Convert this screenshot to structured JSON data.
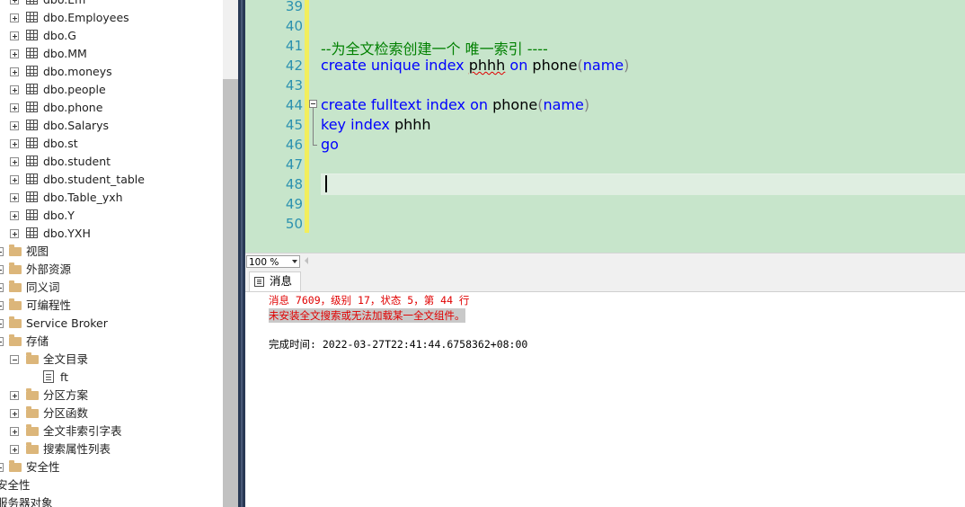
{
  "explorer": {
    "items": [
      {
        "label": "dbo.Em",
        "type": "table"
      },
      {
        "label": "dbo.Employees",
        "type": "table"
      },
      {
        "label": "dbo.G",
        "type": "table"
      },
      {
        "label": "dbo.MM",
        "type": "table"
      },
      {
        "label": "dbo.moneys",
        "type": "table"
      },
      {
        "label": "dbo.people",
        "type": "table"
      },
      {
        "label": "dbo.phone",
        "type": "table"
      },
      {
        "label": "dbo.Salarys",
        "type": "table"
      },
      {
        "label": "dbo.st",
        "type": "table"
      },
      {
        "label": "dbo.student",
        "type": "table"
      },
      {
        "label": "dbo.student_table",
        "type": "table"
      },
      {
        "label": "dbo.Table_yxh",
        "type": "table"
      },
      {
        "label": "dbo.Y",
        "type": "table"
      },
      {
        "label": "dbo.YXH",
        "type": "table"
      },
      {
        "label": "视图",
        "type": "folder"
      },
      {
        "label": "外部资源",
        "type": "folder"
      },
      {
        "label": "同义词",
        "type": "folder"
      },
      {
        "label": "可编程性",
        "type": "folder"
      },
      {
        "label": "Service Broker",
        "type": "folder"
      },
      {
        "label": "存储",
        "type": "folder"
      },
      {
        "label": "全文目录",
        "type": "folder"
      },
      {
        "label": "ft",
        "type": "catalog"
      },
      {
        "label": "分区方案",
        "type": "folder"
      },
      {
        "label": "分区函数",
        "type": "folder"
      },
      {
        "label": "全文非索引字表",
        "type": "folder"
      },
      {
        "label": "搜索属性列表",
        "type": "folder"
      },
      {
        "label": "安全性",
        "type": "folder"
      },
      {
        "label": "安全性",
        "type": "none"
      },
      {
        "label": "服务器对象",
        "type": "none"
      }
    ]
  },
  "editor": {
    "lines": [
      {
        "num": "39",
        "tokens": []
      },
      {
        "num": "40",
        "tokens": []
      },
      {
        "num": "41",
        "tokens": [
          {
            "t": "--为全文检索创建一个 唯一索引 ----",
            "c": "cm"
          }
        ]
      },
      {
        "num": "42",
        "tokens": [
          {
            "t": "create",
            "c": "kw"
          },
          {
            "t": " ",
            "c": "tx"
          },
          {
            "t": "unique",
            "c": "kw"
          },
          {
            "t": " ",
            "c": "tx"
          },
          {
            "t": "index",
            "c": "kw"
          },
          {
            "t": " ",
            "c": "tx"
          },
          {
            "t": "phhh",
            "c": "tx",
            "squiggle": true
          },
          {
            "t": " ",
            "c": "tx"
          },
          {
            "t": "on",
            "c": "kw"
          },
          {
            "t": " phone",
            "c": "tx"
          },
          {
            "t": "(",
            "c": "gr"
          },
          {
            "t": "name",
            "c": "kw"
          },
          {
            "t": ")",
            "c": "gr"
          }
        ]
      },
      {
        "num": "43",
        "tokens": []
      },
      {
        "num": "44",
        "tokens": [
          {
            "t": "create",
            "c": "kw"
          },
          {
            "t": " ",
            "c": "tx"
          },
          {
            "t": "fulltext",
            "c": "kw"
          },
          {
            "t": " ",
            "c": "tx"
          },
          {
            "t": "index",
            "c": "kw"
          },
          {
            "t": " ",
            "c": "tx"
          },
          {
            "t": "on",
            "c": "kw"
          },
          {
            "t": " phone",
            "c": "tx"
          },
          {
            "t": "(",
            "c": "gr"
          },
          {
            "t": "name",
            "c": "kw"
          },
          {
            "t": ")",
            "c": "gr"
          }
        ]
      },
      {
        "num": "45",
        "tokens": [
          {
            "t": "key",
            "c": "kw"
          },
          {
            "t": " ",
            "c": "tx"
          },
          {
            "t": "index",
            "c": "kw"
          },
          {
            "t": " phhh",
            "c": "tx"
          }
        ]
      },
      {
        "num": "46",
        "tokens": [
          {
            "t": "go",
            "c": "kw"
          }
        ]
      },
      {
        "num": "47",
        "tokens": []
      },
      {
        "num": "48",
        "tokens": []
      },
      {
        "num": "49",
        "tokens": []
      },
      {
        "num": "50",
        "tokens": []
      }
    ]
  },
  "zoom": {
    "value": "100 %"
  },
  "results": {
    "tab_label": "消息",
    "error_line": "消息 7609，级别 17，状态 5，第 44 行",
    "error_detail": "未安装全文搜索或无法加载某一全文组件。",
    "completion": "完成时间: 2022-03-27T22:41:44.6758362+08:00"
  },
  "colors": {
    "editor_bg": "#c7e5cb",
    "keyword": "#0000ff",
    "comment": "#008000",
    "line_number": "#2b91af",
    "error": "#e00000",
    "splitter": "#293955"
  }
}
